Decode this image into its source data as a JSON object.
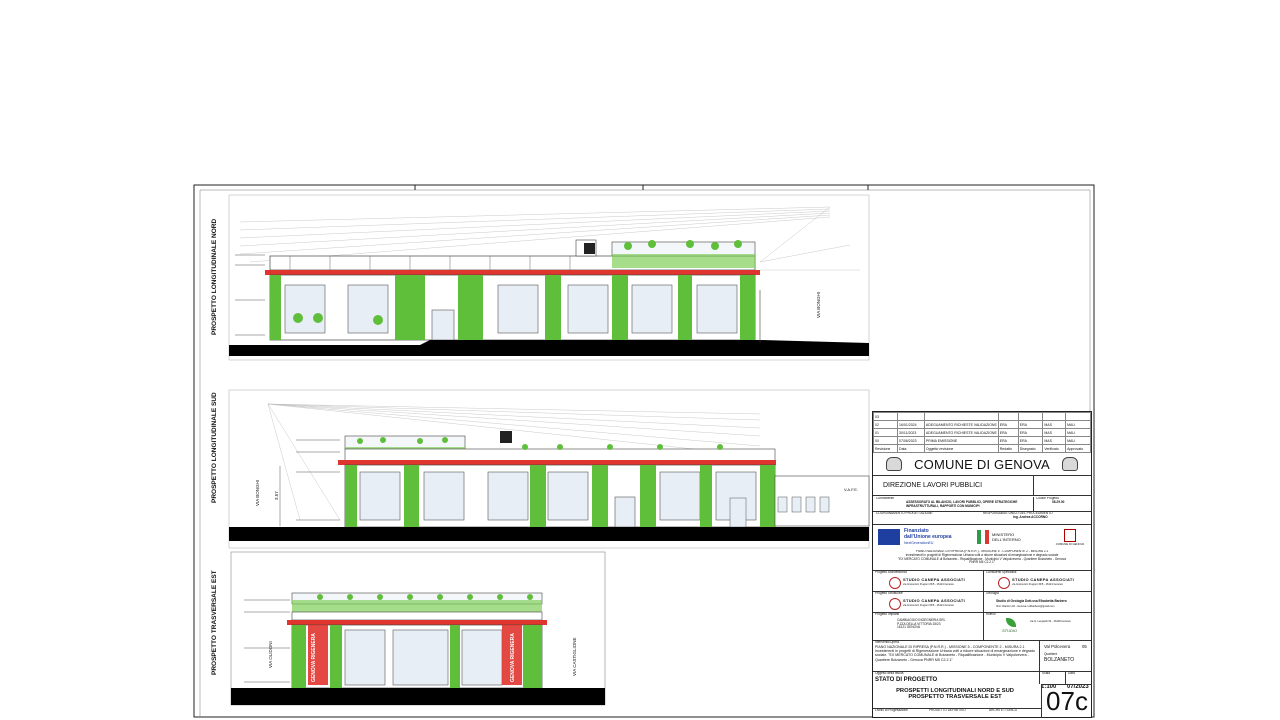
{
  "elevations": {
    "nord": {
      "title": "PROSPETTO LONGITUDINALE NORD",
      "street_right": "VIA BONGHI"
    },
    "sud": {
      "title": "PROSPETTO LONGITUDINALE SUD",
      "street_left": "VIA BONGHI",
      "dimension": "3.57",
      "gate_label": "V.A.F.E."
    },
    "est": {
      "title": "PROSPETTO TRASVERSALE EST",
      "street_left": "VIA OLIDONI",
      "street_right": "VIA CASTIGLIONE",
      "sign_text": "GENOVA RIGENERA"
    }
  },
  "title_block": {
    "revisions": [
      {
        "rev": "03",
        "date": "",
        "desc": "",
        "a": "",
        "b": "",
        "c": "",
        "d": ""
      },
      {
        "rev": "02",
        "date": "16/01/2024",
        "desc": "ADEGUAMENTO RICHIESTE VALIDAZIONE",
        "a": "ERA",
        "b": "ERA",
        "c": "MAS",
        "d": "MAU"
      },
      {
        "rev": "01",
        "date": "30/11/2023",
        "desc": "ADEGUAMENTO RICHIESTE VALIDAZIONE",
        "a": "ERA",
        "b": "ERA",
        "c": "MAS",
        "d": "MAU"
      },
      {
        "rev": "00",
        "date": "07/06/2023",
        "desc": "PRIMA EMISSIONE",
        "a": "ERA",
        "b": "ERA",
        "c": "MAS",
        "d": "MAU"
      },
      {
        "rev": "Revisione",
        "date": "Data",
        "desc": "Oggetto revisione",
        "a": "Redatto",
        "b": "Disegnato",
        "c": "Verificato",
        "d": "Approvato"
      }
    ],
    "comune": "COMUNE DI GENOVA",
    "direzione": "DIREZIONE LAVORI PUBBLICI",
    "committente_label": "Committente",
    "committente": "ASSESSORATO AL BILANCIO, LAVORI PUBBLICI, OPERE STRATEGICHE INFRASTRUTTURALI, RAPPORTI CON MUNICIPI",
    "codice_label": "Codice Progetto",
    "codice": "08.29.00",
    "coordinamento_label": "COORDINAMENTO PROGETTAZIONE",
    "rup_label": "RESPONSABILE UNICO DEL PROCEDIMENTO",
    "rup": "Ing. Andrea ACCORNO",
    "eu_1": "Finanziato",
    "eu_2": "dall'Unione europea",
    "eu_3": "NextGenerationEU",
    "ministero": "MINISTERO DELL'INTERNO",
    "comune_small": "COMUNE DI GENOVA",
    "pnrr_1": "PIANO NAZIONALE DI RIPRESA (P.N.R.R.) - MISSIONE 5 - COMPONENTE 2 - MISURA 2.1",
    "pnrr_2": "Investimenti in progetti di Rigenerazione Urbana volti a ridurre situazioni di emarginazione e degrado sociale",
    "pnrr_3": "\"EX MERCATO COMUNALE di Bolzaneto - Riqualificazione - Municipio V Valpolcevera - Quartiere Bolzaneto - Genova",
    "pnrr_4": "PNRR M5 C2.2.1\"",
    "prog_arch_label": "Progetto Architettonico",
    "studio": "STUDIO CANEPA ASSOCIATI",
    "studio_info": "via Innocenzo Frugoni 15/5 - 16121 Genova",
    "consulente_label": "Consulenti Specialisti",
    "prog_strutt_label": "Progetto Strutturale",
    "geologia_label": "Geologia",
    "geologia": "Studio di Geologia Dott.ssa Elisabetta Barbero",
    "geologia_info": "Vico Cilantro 2/2 - Genova / elibarbero@gmail.com",
    "prog_imp_label": "Progetto Impianti",
    "impianti_1": "CAMBIAGGIO INGEGNERIA SRL",
    "impianti_2": "P.ZZA DELLA VITTORIA 15/23",
    "impianti_3": "16121 GENOVA",
    "rilievo_label": "Rilievo",
    "rilievo_logo": "STUDIO",
    "rilievo_info": "via G. Leopardi 34 - 16129 Genova",
    "intervento_label": "Intervento/Opera",
    "intervento": "PIANO NAZIONALE DI RIPRESA (P.N.R.R.) - MISSIONE 5 - COMPONENTE 2 - MISURA 2.1 Investimenti in progetti di Rigenerazione Urbana volti a ridurre situazioni di emarginazione e degrado sociale. \"EX MERCATO COMUNALE di Bolzaneto - Riqualificazione - Municipio V Valpolcevera - Quartiere Bolzaneto - Genova PNRR M5 C2.2.1\"",
    "municipio": "Val Polcevera",
    "municipio_num": "05",
    "quartiere_label": "Quartiere",
    "quartiere": "BOLZANETO",
    "oggetto_label": "Oggetto della tavola",
    "stato": "STATO DI PROGETTO",
    "oggetto_1": "PROSPETTI LONGITUDINALI NORD E SUD",
    "oggetto_2": "PROSPETTO TRASVERSALE EST",
    "scala_label": "Scala",
    "scala": "1:100",
    "data_label": "Data",
    "data": "07/2023",
    "livello_label": "Livello di Progettazione",
    "livello": "PROGETTO DEFINITIVO",
    "disciplina": "ARCHITETTONICO",
    "codice_mopa_label": "Codice MOGE",
    "codice_mopa": "20371",
    "cup_label": "Codice CUP",
    "cup": "B33C22000160001",
    "cig_label": "Codice CIG",
    "cig": "ZE97C0E6D2",
    "ident_label": "Codice identificativo tavola",
    "tavola": "07c"
  },
  "colors": {
    "roof_band": "#e0342e",
    "greenery": "#5fbf3a",
    "glass": "#e8eef5",
    "ground": "#000000",
    "lines": "#333333"
  }
}
